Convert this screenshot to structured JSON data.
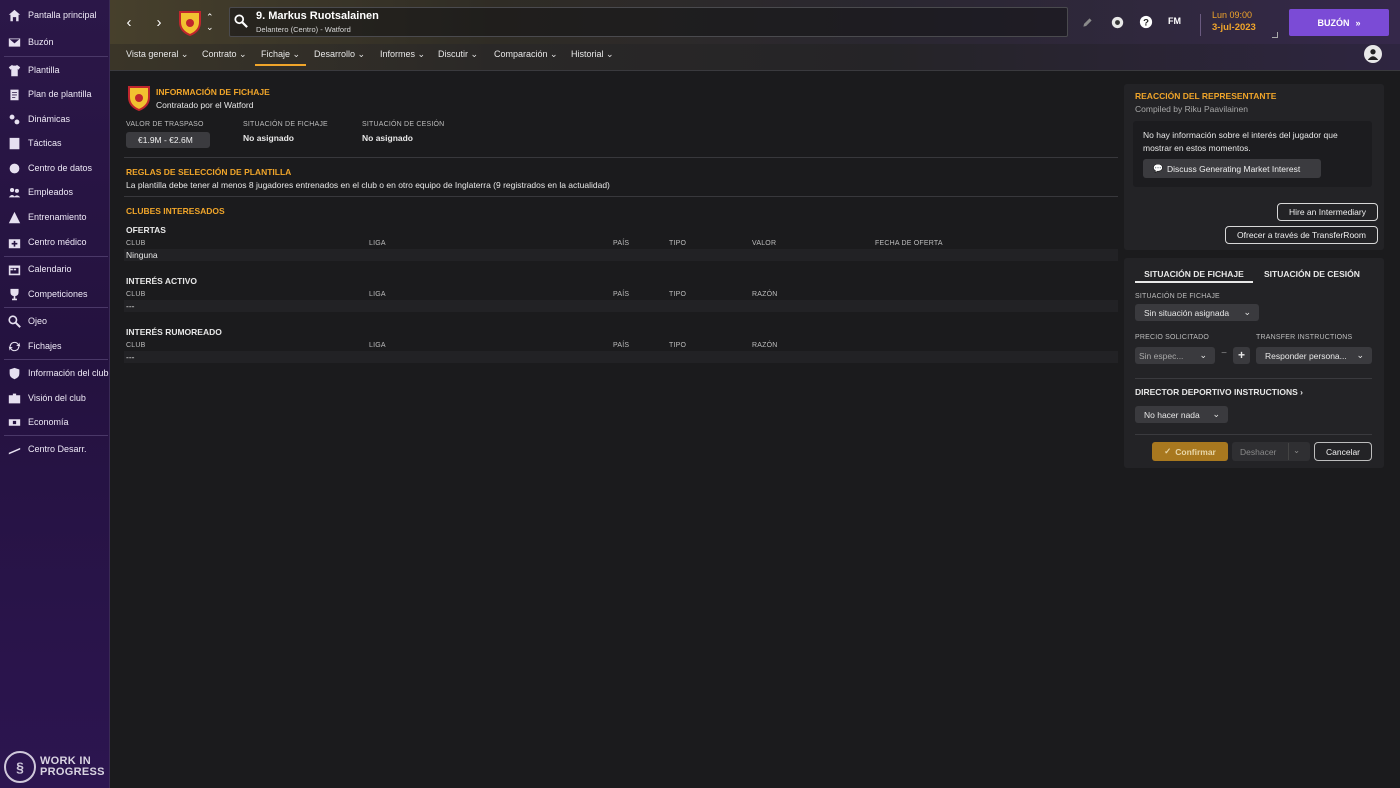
{
  "sidebar": {
    "items": [
      {
        "label": "Pantalla principal",
        "icon": "home-icon"
      },
      {
        "label": "Buzón",
        "icon": "inbox-icon"
      },
      {
        "label": "Plantilla",
        "icon": "shirt-icon"
      },
      {
        "label": "Plan de plantilla",
        "icon": "clipboard-icon"
      },
      {
        "label": "Dinámicas",
        "icon": "dynamics-icon"
      },
      {
        "label": "Tácticas",
        "icon": "tactics-icon"
      },
      {
        "label": "Centro de datos",
        "icon": "data-icon"
      },
      {
        "label": "Empleados",
        "icon": "staff-icon"
      },
      {
        "label": "Entrenamiento",
        "icon": "training-icon"
      },
      {
        "label": "Centro médico",
        "icon": "medical-icon"
      },
      {
        "label": "Calendario",
        "icon": "calendar-icon"
      },
      {
        "label": "Competiciones",
        "icon": "trophy-icon"
      },
      {
        "label": "Ojeo",
        "icon": "scouting-icon"
      },
      {
        "label": "Fichajes",
        "icon": "transfers-icon"
      },
      {
        "label": "Información del club",
        "icon": "shield-icon"
      },
      {
        "label": "Visión del club",
        "icon": "vision-icon"
      },
      {
        "label": "Economía",
        "icon": "finance-icon"
      },
      {
        "label": "Centro Desarr.",
        "icon": "development-icon"
      }
    ],
    "wip_line1": "WORK IN",
    "wip_line2": "PROGRESS"
  },
  "header": {
    "player_name": "9. Markus Ruotsalainen",
    "player_sub": "Delantero (Centro) - Watford",
    "fm_label": "FM",
    "date_time": "Lun 09:00",
    "date_day": "3-jul-2023",
    "buzon_label": "BUZÓN"
  },
  "tabs": [
    {
      "label": "Vista general ⌄"
    },
    {
      "label": "Contrato ⌄"
    },
    {
      "label": "Fichaje ⌄"
    },
    {
      "label": "Desarrollo ⌄"
    },
    {
      "label": "Informes ⌄"
    },
    {
      "label": "Discutir ⌄"
    },
    {
      "label": "Comparación ⌄"
    },
    {
      "label": "Historial ⌄"
    }
  ],
  "main": {
    "info_title": "INFORMACIÓN DE FICHAJE",
    "info_sub": "Contratado por el Watford",
    "valor_label": "VALOR DE TRASPASO",
    "valor_value": "€1.9M - €2.6M",
    "sit_fichaje_label": "SITUACIÓN DE FICHAJE",
    "sit_fichaje_value": "No asignado",
    "sit_cesion_label": "SITUACIÓN DE CESIÓN",
    "sit_cesion_value": "No asignado",
    "reglas_title": "REGLAS DE SELECCIÓN DE PLANTILLA",
    "reglas_text": "La plantilla debe tener al menos 8 jugadores entrenados en el club o en otro equipo de Inglaterra (9 registrados en la actualidad)",
    "clubes_title": "CLUBES INTERESADOS",
    "ofertas": {
      "title": "OFERTAS",
      "headers": [
        "CLUB",
        "LIGA",
        "PAÍS",
        "TIPO",
        "VALOR",
        "FECHA DE OFERTA"
      ],
      "value": "Ninguna"
    },
    "activo": {
      "title": "INTERÉS ACTIVO",
      "headers": [
        "CLUB",
        "LIGA",
        "PAÍS",
        "TIPO",
        "RAZÓN"
      ],
      "value": "---"
    },
    "rumoreado": {
      "title": "INTERÉS RUMOREADO",
      "headers": [
        "CLUB",
        "LIGA",
        "PAÍS",
        "TIPO",
        "RAZÓN"
      ],
      "value": "---"
    }
  },
  "rep": {
    "title": "REACCIÓN DEL REPRESENTANTE",
    "sub": "Compiled by Riku Paavilainen",
    "message": "No hay información sobre el interés del jugador que mostrar en estos momentos.",
    "discuss_label": "Discuss Generating Market Interest",
    "hire_label": "Hire an Intermediary",
    "offer_label": "Ofrecer a través de TransferRoom"
  },
  "trans": {
    "tab1": "SITUACIÓN DE FICHAJE",
    "tab2": "SITUACIÓN DE CESIÓN",
    "sit_label": "SITUACIÓN DE FICHAJE",
    "sit_value": "Sin situación asignada",
    "precio_label": "PRECIO SOLICITADO",
    "precio_value": "Sin espec...",
    "minus": "−",
    "plus": "+",
    "instr_label": "TRANSFER INSTRUCTIONS",
    "instr_value": "Responder persona...",
    "director_label": "DIRECTOR DEPORTIVO INSTRUCTIONS",
    "director_value": "No hacer nada",
    "confirm": "Confirmar",
    "undo": "Deshacer",
    "cancel": "Cancelar"
  },
  "colors": {
    "accent": "#f0a52a",
    "purple": "#7b4bd6"
  }
}
